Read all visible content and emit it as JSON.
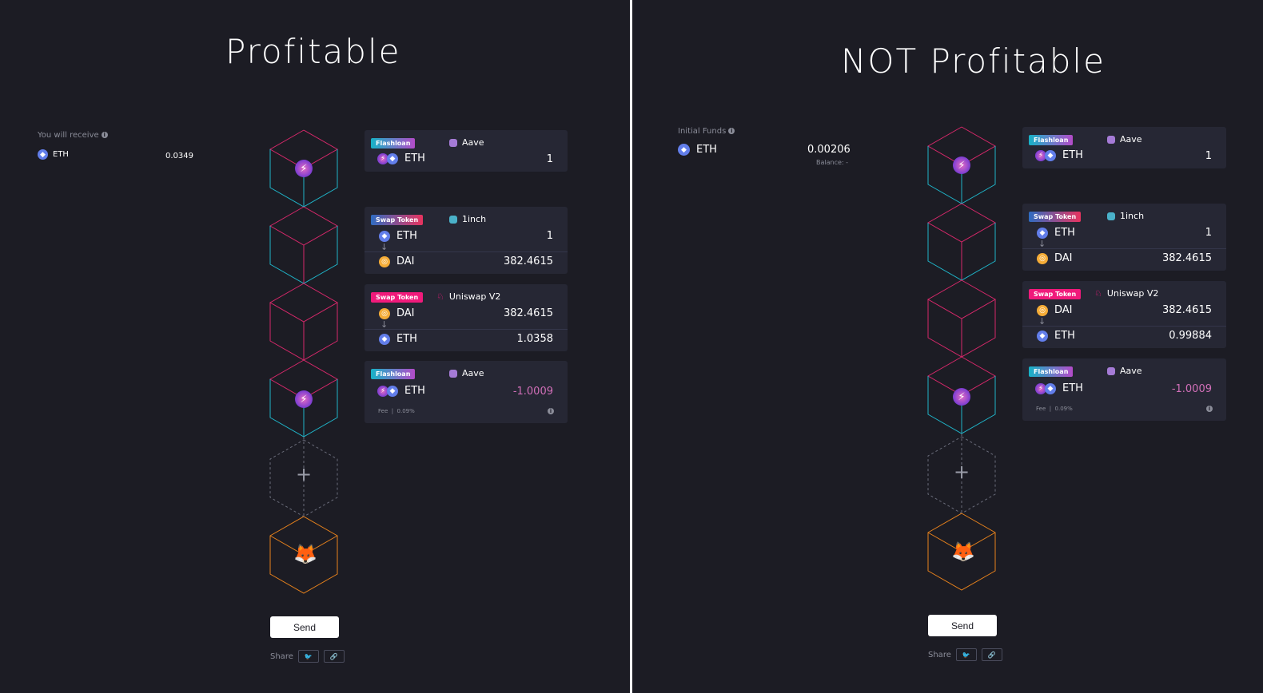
{
  "left": {
    "title": "Profitable",
    "receive_label": "You will receive",
    "receive_token": "ETH",
    "receive_amount": "0.0349",
    "cards": [
      {
        "tag": "Flashloan",
        "protocol": "Aave",
        "token": "ETH",
        "amount": "1"
      },
      {
        "tag": "Swap Token",
        "protocol": "1inch",
        "from_token": "ETH",
        "from_amount": "1",
        "to_token": "DAI",
        "to_amount": "382.4615"
      },
      {
        "tag": "Swap Token",
        "protocol": "Uniswap V2",
        "from_token": "DAI",
        "from_amount": "382.4615",
        "to_token": "ETH",
        "to_amount": "1.0358"
      },
      {
        "tag": "Flashloan",
        "protocol": "Aave",
        "token": "ETH",
        "amount": "-1.0009",
        "fee_label": "Fee",
        "fee_value": "0.09%"
      }
    ],
    "send_label": "Send",
    "share_label": "Share"
  },
  "right": {
    "title": "NOT Profitable",
    "funds_label": "Initial Funds",
    "funds_token": "ETH",
    "funds_amount": "0.00206",
    "balance_label": "Balance: -",
    "cards": [
      {
        "tag": "Flashloan",
        "protocol": "Aave",
        "token": "ETH",
        "amount": "1"
      },
      {
        "tag": "Swap Token",
        "protocol": "1inch",
        "from_token": "ETH",
        "from_amount": "1",
        "to_token": "DAI",
        "to_amount": "382.4615"
      },
      {
        "tag": "Swap Token",
        "protocol": "Uniswap V2",
        "from_token": "DAI",
        "from_amount": "382.4615",
        "to_token": "ETH",
        "to_amount": "0.99884"
      },
      {
        "tag": "Flashloan",
        "protocol": "Aave",
        "token": "ETH",
        "amount": "-1.0009",
        "fee_label": "Fee",
        "fee_value": "0.09%"
      }
    ],
    "send_label": "Send",
    "share_label": "Share"
  },
  "icons": {
    "flashloan": "lightning-icon",
    "add": "plus-icon",
    "wallet": "metamask-fox-icon",
    "twitter": "twitter-icon",
    "link": "link-icon"
  },
  "colors": {
    "background": "#1c1c24",
    "card": "#262734",
    "cube_cyan": "#1fb5c9",
    "cube_pink": "#d6286a",
    "cube_orange": "#e8821c",
    "negative": "#d16fb8"
  }
}
